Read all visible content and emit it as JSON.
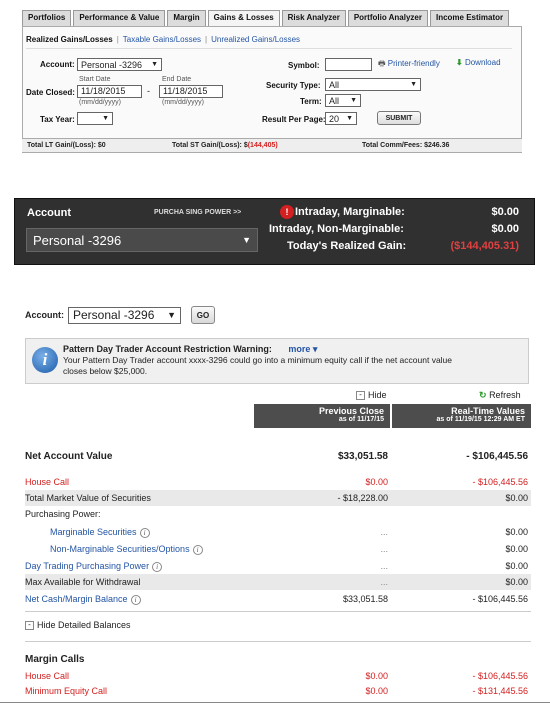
{
  "tabs": [
    "Portfolios",
    "Performance & Value",
    "Margin",
    "Gains & Losses",
    "Risk Analyzer",
    "Portfolio Analyzer",
    "Income Estimator"
  ],
  "active_tab": "Gains & Losses",
  "subnav": {
    "current": "Realized Gains/Losses",
    "taxable": "Taxable Gains/Losses",
    "unrealized": "Unrealized Gains/Losses"
  },
  "form": {
    "account_label": "Account:",
    "account_value": "Personal -3296",
    "date_closed_label": "Date Closed:",
    "start_date_label": "Start Date",
    "end_date_label": "End Date",
    "start_date": "11/18/2015",
    "end_date": "11/18/2015",
    "date_format": "(mm/dd/yyyy)",
    "dash": "-",
    "tax_year_label": "Tax Year:",
    "symbol_label": "Symbol:",
    "security_type_label": "Security Type:",
    "security_type_value": "All",
    "term_label": "Term:",
    "term_value": "All",
    "result_per_page_label": "Result Per Page:",
    "result_per_page_value": "20",
    "submit": "SUBMIT",
    "printer_friendly": "Printer-friendly",
    "download": "Download"
  },
  "totals": {
    "lt_label": "Total LT Gain/(Loss): $0",
    "st_label": "Total ST Gain/(Loss): $",
    "st_value": "(144,405)",
    "comm_label": "Total Comm/Fees: $246.36"
  },
  "dark_bar": {
    "account_label": "Account",
    "purchasing_power": "PURCHA SING POWER >>",
    "account_value": "Personal -3296",
    "intraday_marginable_label": "Intraday, Marginable:",
    "intraday_marginable_value": "$0.00",
    "intraday_nonmarginable_label": "Intraday, Non-Marginable:",
    "intraday_nonmarginable_value": "$0.00",
    "realized_gain_label": "Today's Realized Gain:",
    "realized_gain_value": "($144,405.31)"
  },
  "account_select": {
    "label": "Account:",
    "value": "Personal -3296",
    "go": "GO"
  },
  "warning": {
    "title": "Pattern Day Trader Account Restriction Warning:",
    "more": "more",
    "line1": "Your Pattern Day Trader account xxxx-3296 could go into a minimum equity call if the net account value",
    "line2": "closes below $25,000."
  },
  "controls": {
    "hide": "Hide",
    "refresh": "Refresh"
  },
  "headers": {
    "previous_close": "Previous Close",
    "previous_close_date": "as of 11/17/15",
    "real_time": "Real-Time Values",
    "real_time_date": "as of 11/19/15 12:29 AM ET"
  },
  "balances": {
    "net_account_value": {
      "label": "Net Account Value",
      "prev": "$33,051.58",
      "rt": "- $106,445.56"
    },
    "house_call": {
      "label": "House Call",
      "prev": "$0.00",
      "rt": "- $106,445.56"
    },
    "total_market_value": {
      "label": "Total Market Value of Securities",
      "prev": "- $18,228.00",
      "rt": "$0.00"
    },
    "purchasing_power": {
      "label": "Purchasing Power:"
    },
    "marginable": {
      "label": "Marginable Securities",
      "prev": "...",
      "rt": "$0.00"
    },
    "non_marginable": {
      "label": "Non-Marginable Securities/Options",
      "prev": "...",
      "rt": "$0.00"
    },
    "day_trading_pp": {
      "label": "Day Trading Purchasing Power",
      "prev": "...",
      "rt": "$0.00"
    },
    "max_withdrawal": {
      "label": "Max Available for Withdrawal",
      "prev": "...",
      "rt": "$0.00"
    },
    "net_cash": {
      "label": "Net Cash/Margin Balance",
      "prev": "$33,051.58",
      "rt": "- $106,445.56"
    }
  },
  "hide_detailed": "Hide Detailed Balances",
  "margin_calls": {
    "title": "Margin Calls",
    "house_call": {
      "label": "House Call",
      "prev": "$0.00",
      "rt": "- $106,445.56"
    },
    "min_equity": {
      "label": "Minimum Equity Call",
      "prev": "$0.00",
      "rt": "- $131,445.56"
    }
  },
  "info_glyph": "i"
}
